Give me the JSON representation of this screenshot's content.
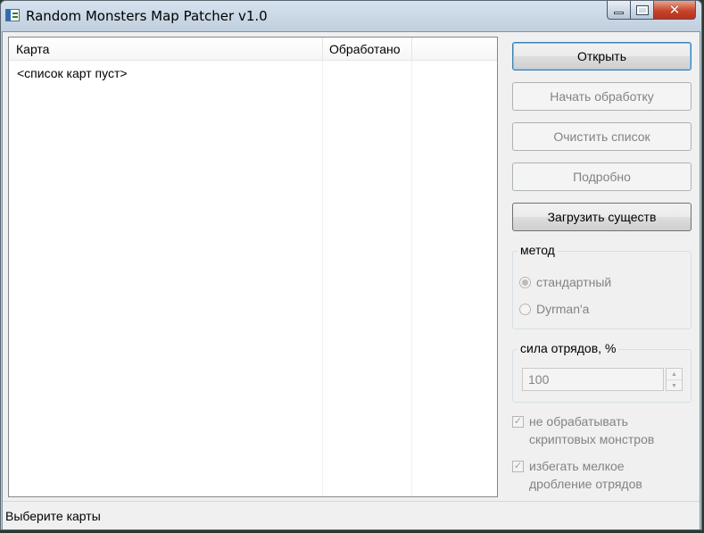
{
  "window": {
    "title": "Random Monsters Map Patcher v1.0",
    "controls": {
      "minimize": "minimize",
      "maximize": "maximize",
      "close": "✕"
    }
  },
  "map_list": {
    "columns": [
      "Карта",
      "Обработано"
    ],
    "empty_text": "<список карт пуст>"
  },
  "buttons": {
    "open": "Открыть",
    "start": "Начать обработку",
    "clear": "Очистить список",
    "details": "Подробно",
    "load_creatures": "Загрузить существ"
  },
  "method": {
    "label": "метод",
    "options": [
      {
        "label": "стандартный",
        "selected": true
      },
      {
        "label": "Dyrman'a",
        "selected": false
      }
    ]
  },
  "strength": {
    "label": "сила отрядов, %",
    "value": "100"
  },
  "options": {
    "skip_script_monsters": {
      "line1": "не обрабатывать",
      "line2": "скриптовых монстров",
      "checked": true
    },
    "avoid_splitting": {
      "line1": "избегать мелкое",
      "line2": "дробление отрядов",
      "checked": true
    }
  },
  "status": {
    "text": "Выберите карты"
  }
}
